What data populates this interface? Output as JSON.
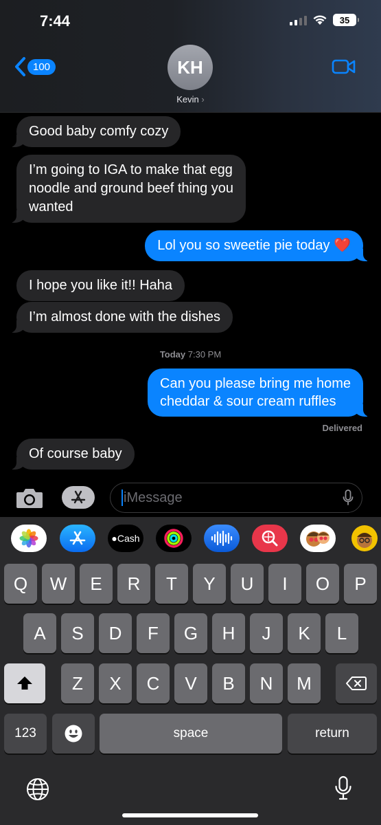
{
  "status_bar": {
    "time": "7:44",
    "battery": "35"
  },
  "nav": {
    "back_count": "100",
    "contact_initials": "KH",
    "contact_name": "Kevin",
    "contact_chevron": "›"
  },
  "messages": [
    {
      "direction": "incoming",
      "text": "Good baby comfy cozy"
    },
    {
      "direction": "incoming",
      "lines": [
        "I’m going to IGA to make that egg",
        "noodle and ground beef thing you",
        "wanted"
      ]
    },
    {
      "direction": "outgoing",
      "text": "Lol you so sweetie pie today ❤️"
    },
    {
      "direction": "incoming",
      "text": "I hope you like it!! Haha"
    },
    {
      "direction": "incoming",
      "text": "I’m almost done with the dishes"
    },
    {
      "direction": "outgoing",
      "lines": [
        "Can you please bring me home",
        "cheddar & sour cream ruffles"
      ]
    },
    {
      "direction": "incoming",
      "text": "Of course baby"
    }
  ],
  "timestamp": {
    "day": "Today",
    "time": "7:30 PM"
  },
  "delivered_label": "Delivered",
  "composer": {
    "placeholder": "iMessage"
  },
  "app_strip": [
    {
      "name": "Photos",
      "icon": "photos-icon"
    },
    {
      "name": "App Store",
      "icon": "app-store-icon"
    },
    {
      "name": "Cash",
      "icon": "apple-cash-icon",
      "label": "Cash"
    },
    {
      "name": "Activity",
      "icon": "activity-rings-icon"
    },
    {
      "name": "Audio",
      "icon": "audio-message-icon"
    },
    {
      "name": "Search",
      "icon": "image-search-icon"
    },
    {
      "name": "Memoji stickers",
      "icon": "memoji-stickers-icon"
    },
    {
      "name": "Memoji",
      "icon": "memoji-icon"
    }
  ],
  "keyboard": {
    "row1": [
      "Q",
      "W",
      "E",
      "R",
      "T",
      "Y",
      "U",
      "I",
      "O",
      "P"
    ],
    "row2": [
      "A",
      "S",
      "D",
      "F",
      "G",
      "H",
      "J",
      "K",
      "L"
    ],
    "row3": [
      "Z",
      "X",
      "C",
      "V",
      "B",
      "N",
      "M"
    ],
    "numbers_label": "123",
    "space_label": "space",
    "return_label": "return"
  },
  "colors": {
    "accent": "#0a84ff",
    "incoming_bubble": "#262628",
    "keyboard_bg": "#2a2a2c",
    "key": "#6b6b6f"
  }
}
